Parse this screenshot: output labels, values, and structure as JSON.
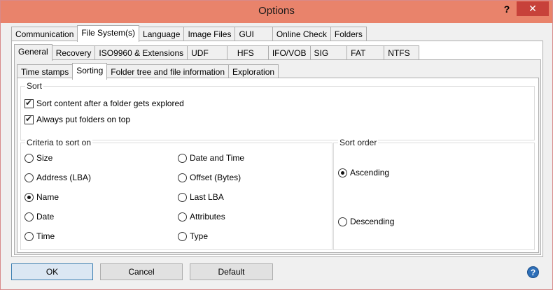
{
  "window": {
    "title": "Options",
    "help_label": "?",
    "close_label": "✕"
  },
  "tabs_level1": [
    "Communication",
    "File System(s)",
    "Language",
    "Image Files",
    "GUI",
    "Online Check",
    "Folders"
  ],
  "tabs_level1_active": "File System(s)",
  "tabs_level2": [
    "General",
    "Recovery",
    "ISO9960 & Extensions",
    "UDF",
    "HFS",
    "IFO/VOB",
    "SIG",
    "FAT",
    "NTFS"
  ],
  "tabs_level2_active": "General",
  "tabs_level3": [
    "Time stamps",
    "Sorting",
    "Folder tree and file information",
    "Exploration"
  ],
  "tabs_level3_active": "Sorting",
  "sort": {
    "title": "Sort",
    "sort_after_explored": {
      "label": "Sort content after a folder gets explored",
      "checked": true
    },
    "folders_on_top": {
      "label": "Always put folders on top",
      "checked": true
    }
  },
  "criteria": {
    "title": "Criteria to sort on",
    "options": [
      "Size",
      "Address (LBA)",
      "Name",
      "Date",
      "Time",
      "Date and Time",
      "Offset (Bytes)",
      "Last LBA",
      "Attributes",
      "Type"
    ],
    "selected": "Name"
  },
  "sort_order": {
    "title": "Sort order",
    "options": [
      "Ascending",
      "Descending"
    ],
    "selected": "Ascending"
  },
  "buttons": {
    "ok": "OK",
    "cancel": "Cancel",
    "default": "Default",
    "help": "?"
  }
}
